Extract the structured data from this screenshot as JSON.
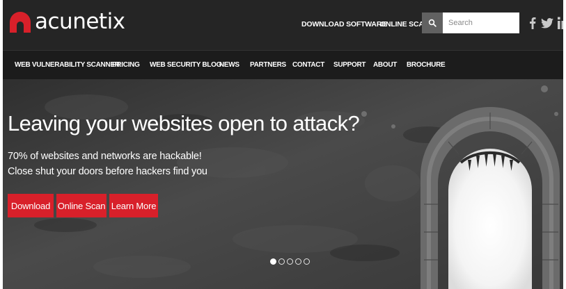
{
  "brand": {
    "name": "acunetix",
    "accent_color": "#d8202a",
    "logo_icon": "acunetix-logo-icon"
  },
  "header": {
    "links": [
      {
        "label": "DOWNLOAD SOFTWARE"
      },
      {
        "label": "ONLINE SCAN"
      }
    ],
    "search": {
      "icon": "search-icon",
      "placeholder": "Search"
    },
    "social": [
      {
        "icon": "facebook-icon"
      },
      {
        "icon": "twitter-icon"
      },
      {
        "icon": "linkedin-icon"
      }
    ]
  },
  "nav": {
    "items": [
      {
        "label": "WEB VULNERABILITY SCANNER"
      },
      {
        "label": "PRICING"
      },
      {
        "label": "WEB SECURITY BLOG"
      },
      {
        "label": "NEWS"
      },
      {
        "label": "PARTNERS"
      },
      {
        "label": "CONTACT"
      },
      {
        "label": "SUPPORT"
      },
      {
        "label": "ABOUT"
      },
      {
        "label": "BROCHURE"
      }
    ]
  },
  "hero": {
    "title": "Leaving your websites open to attack?",
    "line1": "70% of websites and networks are hackable!",
    "line2": "Close shut your doors before hackers find you",
    "buttons": [
      {
        "label": "Download"
      },
      {
        "label": "Online Scan"
      },
      {
        "label": "Learn More"
      }
    ],
    "slides": {
      "count": 5,
      "active": 1
    }
  }
}
